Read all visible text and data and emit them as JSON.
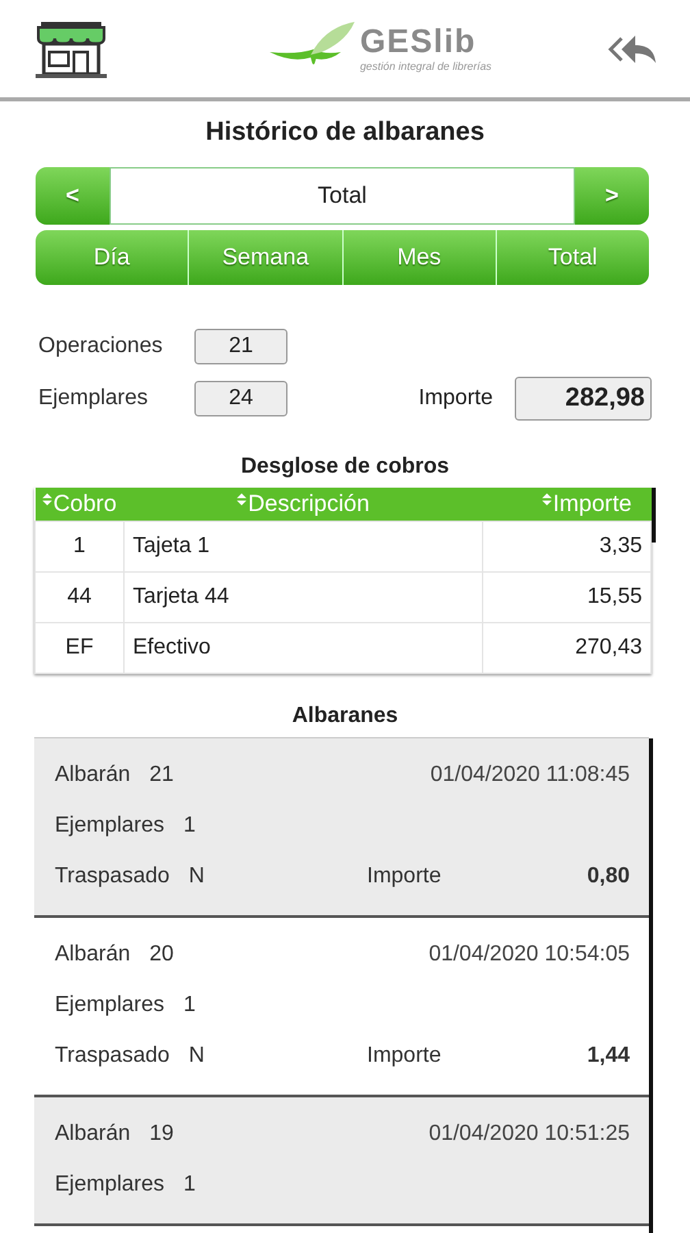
{
  "header": {
    "logo_text": "GESlib",
    "logo_tagline": "gestión integral de librerías"
  },
  "title": "Histórico de albaranes",
  "period_nav": {
    "prev": "<",
    "value": "Total",
    "next": ">"
  },
  "period_tabs": [
    "Día",
    "Semana",
    "Mes",
    "Total"
  ],
  "summary": {
    "operaciones_label": "Operaciones",
    "operaciones": "21",
    "ejemplares_label": "Ejemplares",
    "ejemplares": "24",
    "importe_label": "Importe",
    "importe": "282,98"
  },
  "payments": {
    "title": "Desglose de cobros",
    "columns": [
      "Cobro",
      "Descripción",
      "Importe"
    ],
    "rows": [
      [
        "1",
        "Tajeta 1",
        "3,35"
      ],
      [
        "44",
        "Tarjeta 44",
        "15,55"
      ],
      [
        "EF",
        "Efectivo",
        "270,43"
      ]
    ]
  },
  "delivery_notes": {
    "title": "Albaranes",
    "items": [
      {
        "albaran_label": "Albarán",
        "albaran": "21",
        "datetime": "01/04/2020 11:08:45",
        "ejemplares_label": "Ejemplares",
        "ejemplares": "1",
        "traspasado_label": "Traspasado",
        "traspasado": "N",
        "importe_label": "Importe",
        "importe": "0,80"
      },
      {
        "albaran_label": "Albarán",
        "albaran": "20",
        "datetime": "01/04/2020 10:54:05",
        "ejemplares_label": "Ejemplares",
        "ejemplares": "1",
        "traspasado_label": "Traspasado",
        "traspasado": "N",
        "importe_label": "Importe",
        "importe": "1,44"
      },
      {
        "albaran_label": "Albarán",
        "albaran": "19",
        "datetime": "01/04/2020 10:51:25",
        "ejemplares_label": "Ejemplares",
        "ejemplares": "1"
      }
    ]
  }
}
